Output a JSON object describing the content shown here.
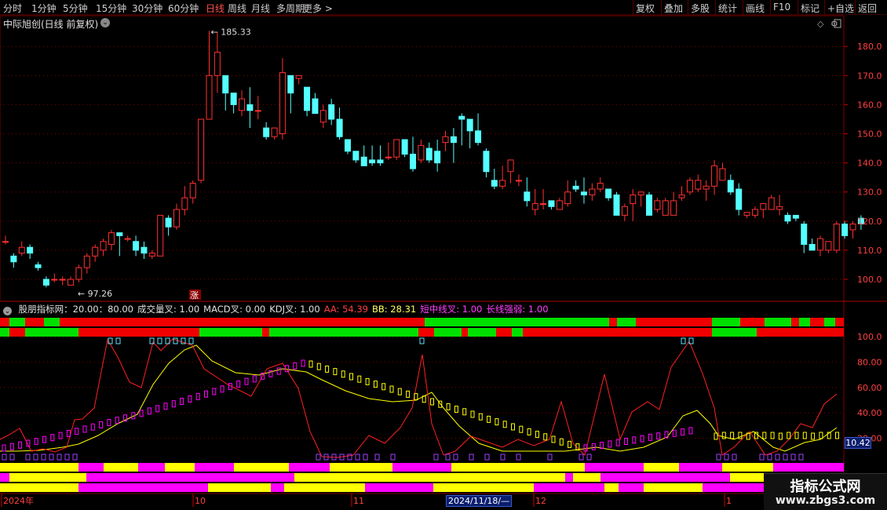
{
  "toolbar": {
    "left": [
      "分时",
      "1分钟",
      "5分钟",
      "15分钟",
      "30分钟",
      "60分钟",
      "日线",
      "周线",
      "月线",
      "多周期",
      "更多 >"
    ],
    "active": "日线",
    "right": [
      "复权",
      "叠加",
      "多股",
      "统计",
      "画线",
      "F10",
      "标记",
      "+自选",
      "返回"
    ]
  },
  "main_chart": {
    "title": "中际旭创(日线 前复权)",
    "high_label": "185.33",
    "low_label": "97.26",
    "badge": "涨",
    "y_axis": [
      "180.0",
      "170.0",
      "160.0",
      "150.0",
      "140.0",
      "130.0",
      "120.0",
      "110.0",
      "100.0"
    ]
  },
  "indicator": {
    "legend": [
      {
        "text": "股朋指标网：20.00：80.00",
        "color": "#e0e0e0"
      },
      {
        "text": "成交量叉: 1.00",
        "color": "#e0e0e0"
      },
      {
        "text": "MACD叉: 0.00",
        "color": "#e0e0e0"
      },
      {
        "text": "KDJ叉: 1.00",
        "color": "#e0e0e0"
      },
      {
        "text": "AA: 54.39",
        "color": "#ff4040"
      },
      {
        "text": "BB: 28.31",
        "color": "#ffff60"
      },
      {
        "text": "短中线叉: 1.00",
        "color": "#ff40ff"
      },
      {
        "text": "长线强弱: 1.00",
        "color": "#ff40ff"
      }
    ],
    "y_axis": [
      "100.0",
      "80.00",
      "60.00",
      "40.00",
      "20.00"
    ],
    "current_value": "10.42"
  },
  "x_axis": {
    "labels": [
      "2024年",
      "10",
      "11",
      "12",
      "1"
    ],
    "cursor_date": "2024/11/18/—"
  },
  "watermark": {
    "title": "指标公式网",
    "url": "www.zbgs3.com"
  },
  "colors": {
    "up": "#ff3030",
    "down": "#54ffff",
    "green": "#00e000",
    "magenta": "#ff00ff",
    "yellow": "#ffff00",
    "grid": "#800000"
  },
  "chart_data": {
    "type": "candlestick",
    "ylim": [
      95,
      188
    ],
    "candles": [
      [
        113,
        113,
        115,
        112
      ],
      [
        108,
        106,
        109,
        104
      ],
      [
        109,
        111,
        113,
        108
      ],
      [
        111,
        109,
        112,
        107
      ],
      [
        105,
        104,
        106,
        103
      ],
      [
        100,
        98,
        101,
        97.26
      ],
      [
        100,
        100,
        102,
        99
      ],
      [
        100,
        100,
        101,
        98
      ],
      [
        98,
        100,
        101,
        98
      ],
      [
        100,
        104,
        105,
        99
      ],
      [
        104,
        108,
        109,
        102
      ],
      [
        108,
        111,
        112,
        106
      ],
      [
        110,
        113,
        114,
        108
      ],
      [
        112,
        116,
        117,
        110
      ],
      [
        116,
        115,
        116,
        108
      ],
      [
        114,
        114,
        115,
        113
      ],
      [
        113,
        110,
        115,
        108
      ],
      [
        111,
        109,
        113,
        107
      ],
      [
        108,
        109,
        110,
        107
      ],
      [
        108,
        122,
        122,
        108
      ],
      [
        121,
        118,
        122,
        115
      ],
      [
        118,
        124,
        126,
        117
      ],
      [
        124,
        128,
        132,
        122
      ],
      [
        128,
        133,
        134,
        126
      ],
      [
        134,
        155,
        155,
        133
      ],
      [
        155,
        170,
        185.33,
        164
      ],
      [
        170,
        178,
        185,
        164
      ],
      [
        170,
        164,
        170,
        158
      ],
      [
        164,
        160,
        163,
        157
      ],
      [
        158,
        162,
        165,
        156
      ],
      [
        160,
        158,
        166,
        152
      ],
      [
        158,
        158,
        163,
        155
      ],
      [
        152,
        149,
        154,
        148
      ],
      [
        149,
        152,
        152,
        148
      ],
      [
        150,
        171,
        176,
        148
      ],
      [
        170,
        164,
        168,
        157
      ],
      [
        169,
        170,
        170,
        167
      ],
      [
        166,
        158,
        166,
        156
      ],
      [
        162,
        157,
        164,
        157
      ],
      [
        154,
        158,
        160,
        152
      ],
      [
        160,
        155,
        162,
        153
      ],
      [
        155,
        149,
        159,
        148
      ],
      [
        148,
        144,
        148,
        143
      ],
      [
        144,
        141,
        144,
        140
      ],
      [
        142,
        139,
        146,
        139
      ],
      [
        141,
        140,
        146,
        139
      ],
      [
        141,
        140,
        146,
        139
      ],
      [
        142,
        142,
        147,
        141
      ],
      [
        142,
        148,
        148,
        141
      ],
      [
        148,
        143,
        148,
        142
      ],
      [
        143,
        138,
        149,
        137
      ],
      [
        141,
        146,
        148,
        140
      ],
      [
        145,
        141,
        147,
        140
      ],
      [
        144,
        140,
        148,
        137
      ],
      [
        147,
        149,
        151,
        144
      ],
      [
        149,
        147,
        152,
        140
      ],
      [
        156,
        155,
        157,
        146
      ],
      [
        155,
        151,
        155,
        145
      ],
      [
        151,
        147,
        157,
        146
      ],
      [
        144,
        137,
        145,
        135
      ],
      [
        134,
        132,
        138,
        131
      ],
      [
        132,
        134,
        139,
        131
      ],
      [
        137,
        141,
        141,
        133
      ],
      [
        134,
        134,
        136,
        132
      ],
      [
        130,
        127,
        135,
        125
      ],
      [
        124,
        126,
        131,
        122
      ],
      [
        126,
        126,
        131,
        124
      ],
      [
        127,
        125,
        127,
        124
      ],
      [
        124,
        127,
        128,
        124
      ],
      [
        126,
        130,
        134,
        125
      ],
      [
        132,
        131,
        134,
        130
      ],
      [
        130,
        129,
        135,
        126
      ],
      [
        129,
        131,
        133,
        127
      ],
      [
        131,
        133,
        135,
        130
      ],
      [
        131,
        128,
        131,
        127
      ],
      [
        129,
        122,
        130,
        122
      ],
      [
        122,
        125,
        126,
        120
      ],
      [
        126,
        129,
        131,
        120
      ],
      [
        129,
        130,
        130,
        125
      ],
      [
        129,
        122,
        130,
        122
      ],
      [
        124,
        127,
        128,
        123
      ],
      [
        122,
        127,
        128,
        122
      ],
      [
        122,
        127,
        130,
        123
      ],
      [
        128,
        129,
        132,
        127
      ],
      [
        130,
        134,
        135,
        129
      ],
      [
        131,
        134,
        136,
        130
      ],
      [
        131,
        132,
        134,
        127
      ],
      [
        132,
        139,
        141,
        129
      ],
      [
        134,
        138,
        140,
        134
      ],
      [
        134,
        130,
        136,
        129
      ],
      [
        131,
        124,
        133,
        122
      ],
      [
        122,
        123,
        123,
        121
      ],
      [
        122,
        124,
        125,
        121
      ],
      [
        124,
        126,
        126,
        121
      ],
      [
        124,
        128,
        129,
        124
      ],
      [
        124,
        125,
        129,
        122
      ],
      [
        122,
        120,
        123,
        119
      ],
      [
        122,
        121,
        121,
        120
      ],
      [
        119,
        112,
        120,
        109
      ],
      [
        112,
        110,
        114,
        110
      ],
      [
        110,
        114,
        115,
        108
      ],
      [
        110,
        113,
        113,
        109
      ],
      [
        110,
        119,
        120,
        109
      ],
      [
        119,
        115,
        120,
        114
      ],
      [
        117,
        119,
        120,
        114
      ],
      [
        121,
        119,
        122,
        117
      ]
    ]
  }
}
